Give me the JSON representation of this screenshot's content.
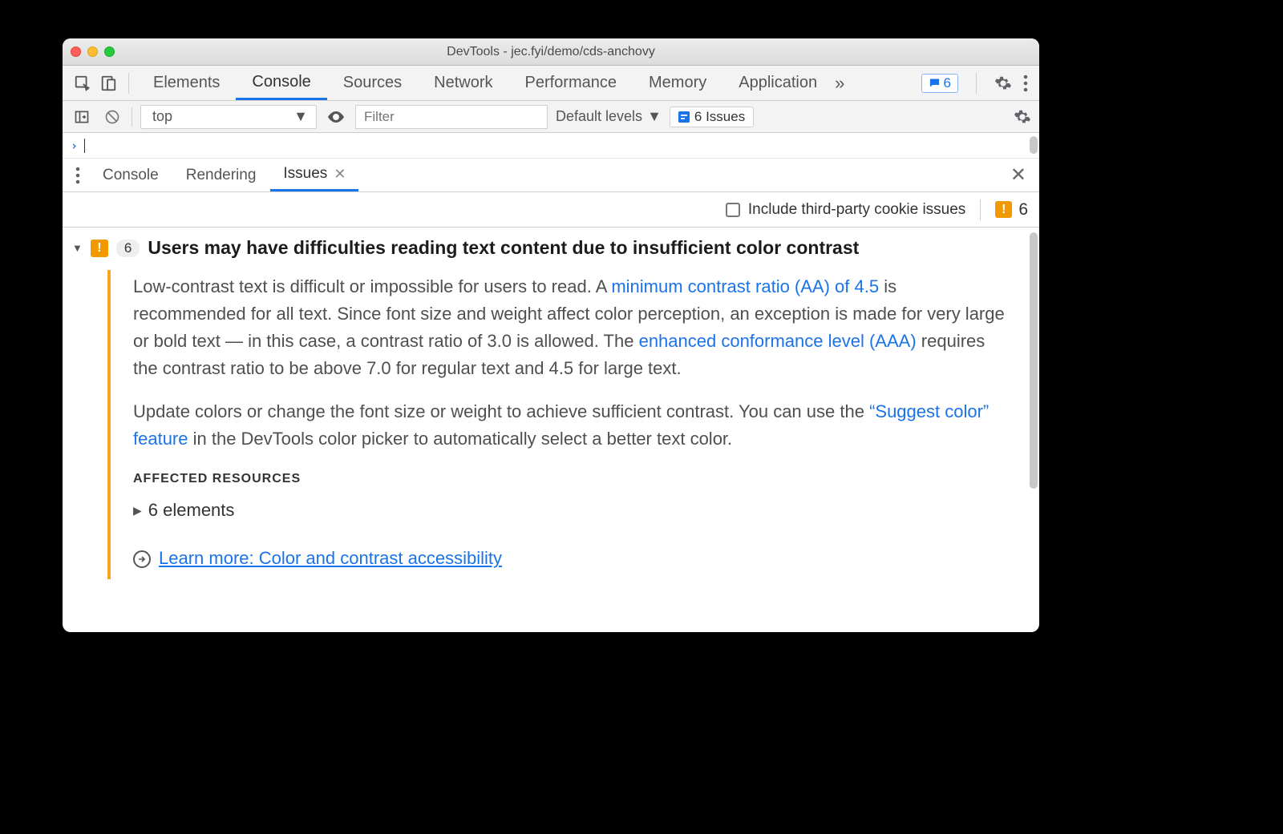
{
  "window": {
    "title": "DevTools - jec.fyi/demo/cds-anchovy"
  },
  "mainTabs": {
    "items": [
      "Elements",
      "Console",
      "Sources",
      "Network",
      "Performance",
      "Memory",
      "Application"
    ],
    "activeIndex": 1,
    "overflowCount": "6"
  },
  "consoleToolbar": {
    "context": "top",
    "filterPlaceholder": "Filter",
    "levels": "Default levels",
    "issuesChip": "6 Issues"
  },
  "drawer": {
    "tabs": [
      "Console",
      "Rendering",
      "Issues"
    ],
    "activeIndex": 2,
    "checkboxLabel": "Include third-party cookie issues",
    "issuesBadge": "6"
  },
  "issue": {
    "count": "6",
    "title": "Users may have difficulties reading text content due to insufficient color contrast",
    "p1a": "Low-contrast text is difficult or impossible for users to read. A ",
    "link1": "minimum contrast ratio (AA) of 4.5",
    "p1b": " is recommended for all text. Since font size and weight affect color perception, an exception is made for very large or bold text — in this case, a contrast ratio of 3.0 is allowed. The ",
    "link2": "enhanced conformance level (AAA)",
    "p1c": " requires the contrast ratio to be above 7.0 for regular text and 4.5 for large text.",
    "p2a": "Update colors or change the font size or weight to achieve sufficient contrast. You can use the ",
    "link3": "“Suggest color” feature",
    "p2b": " in the DevTools color picker to automatically select a better text color.",
    "affectedLabel": "AFFECTED RESOURCES",
    "elementsLine": "6 elements",
    "learnMore": "Learn more: Color and contrast accessibility"
  }
}
